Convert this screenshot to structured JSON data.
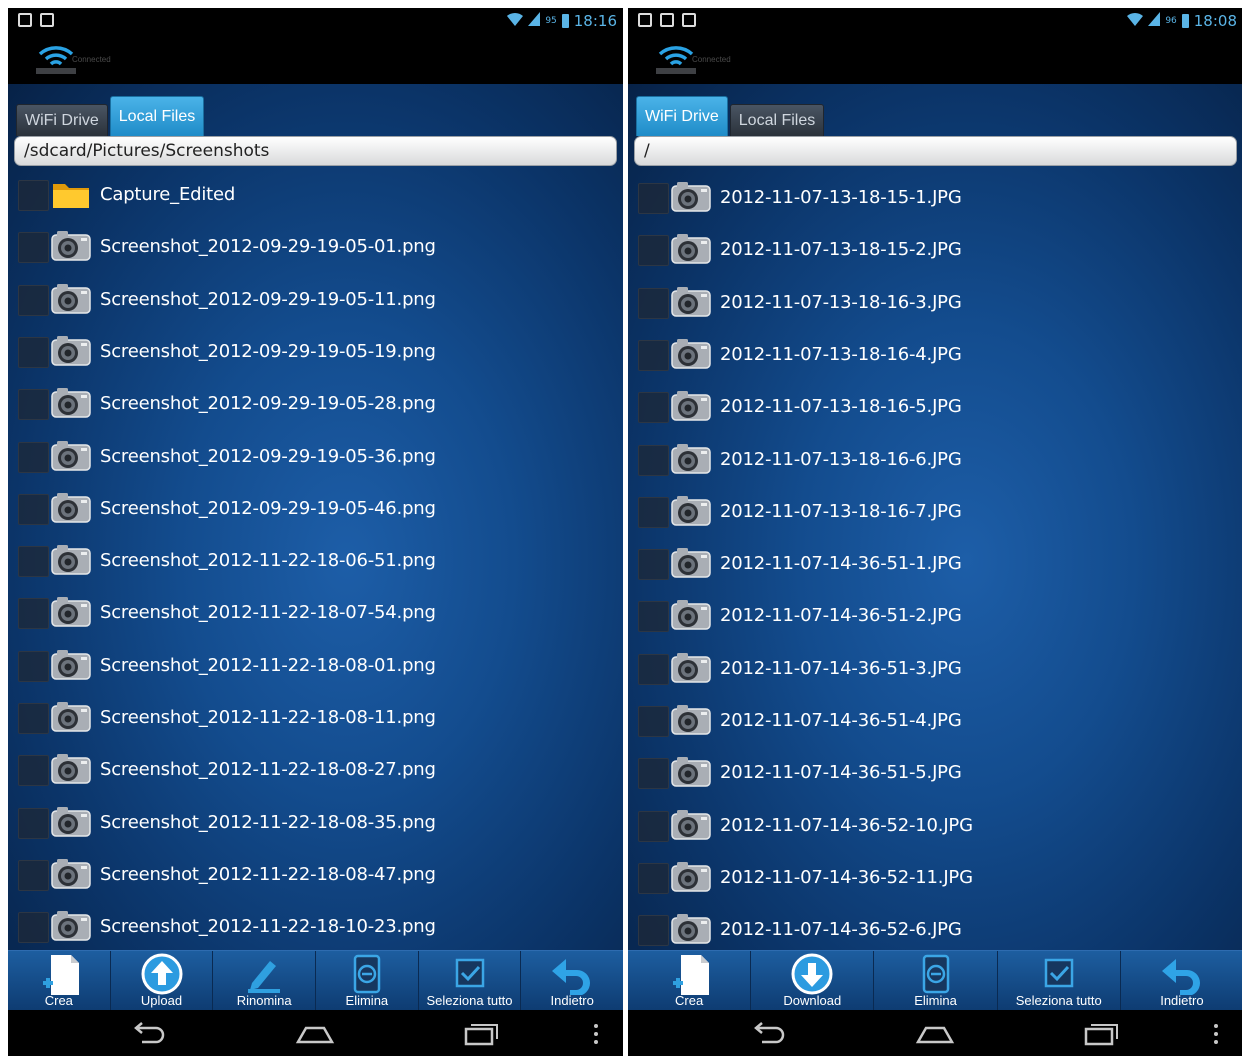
{
  "left": {
    "status": {
      "battery": "95",
      "time": "18:16"
    },
    "wifi_status": "Connected",
    "tabs": [
      {
        "label": "WiFi Drive",
        "active": false
      },
      {
        "label": "Local Files",
        "active": true
      }
    ],
    "path": "/sdcard/Pictures/Screenshots",
    "files": [
      {
        "name": "Capture_Edited",
        "icon": "folder-icon"
      },
      {
        "name": "Screenshot_2012-09-29-19-05-01.png",
        "icon": "camera-icon"
      },
      {
        "name": "Screenshot_2012-09-29-19-05-11.png",
        "icon": "camera-icon"
      },
      {
        "name": "Screenshot_2012-09-29-19-05-19.png",
        "icon": "camera-icon"
      },
      {
        "name": "Screenshot_2012-09-29-19-05-28.png",
        "icon": "camera-icon"
      },
      {
        "name": "Screenshot_2012-09-29-19-05-36.png",
        "icon": "camera-icon"
      },
      {
        "name": "Screenshot_2012-09-29-19-05-46.png",
        "icon": "camera-icon"
      },
      {
        "name": "Screenshot_2012-11-22-18-06-51.png",
        "icon": "camera-icon"
      },
      {
        "name": "Screenshot_2012-11-22-18-07-54.png",
        "icon": "camera-icon"
      },
      {
        "name": "Screenshot_2012-11-22-18-08-01.png",
        "icon": "camera-icon"
      },
      {
        "name": "Screenshot_2012-11-22-18-08-11.png",
        "icon": "camera-icon"
      },
      {
        "name": "Screenshot_2012-11-22-18-08-27.png",
        "icon": "camera-icon"
      },
      {
        "name": "Screenshot_2012-11-22-18-08-35.png",
        "icon": "camera-icon"
      },
      {
        "name": "Screenshot_2012-11-22-18-08-47.png",
        "icon": "camera-icon"
      },
      {
        "name": "Screenshot_2012-11-22-18-10-23.png",
        "icon": "camera-icon"
      }
    ],
    "toolbar": [
      {
        "label": "Crea",
        "icon": "new-file-icon"
      },
      {
        "label": "Upload",
        "icon": "upload-icon"
      },
      {
        "label": "Rinomina",
        "icon": "rename-icon"
      },
      {
        "label": "Elimina",
        "icon": "delete-icon"
      },
      {
        "label": "Seleziona tutto",
        "icon": "select-all-icon"
      },
      {
        "label": "Indietro",
        "icon": "back-arrow-icon"
      }
    ]
  },
  "right": {
    "status": {
      "battery": "96",
      "time": "18:08"
    },
    "wifi_status": "Connected",
    "tabs": [
      {
        "label": "WiFi Drive",
        "active": true
      },
      {
        "label": "Local Files",
        "active": false
      }
    ],
    "path": "/",
    "files": [
      {
        "name": "2012-11-07-13-18-15-1.JPG",
        "icon": "camera-icon"
      },
      {
        "name": "2012-11-07-13-18-15-2.JPG",
        "icon": "camera-icon"
      },
      {
        "name": "2012-11-07-13-18-16-3.JPG",
        "icon": "camera-icon"
      },
      {
        "name": "2012-11-07-13-18-16-4.JPG",
        "icon": "camera-icon"
      },
      {
        "name": "2012-11-07-13-18-16-5.JPG",
        "icon": "camera-icon"
      },
      {
        "name": "2012-11-07-13-18-16-6.JPG",
        "icon": "camera-icon"
      },
      {
        "name": "2012-11-07-13-18-16-7.JPG",
        "icon": "camera-icon"
      },
      {
        "name": "2012-11-07-14-36-51-1.JPG",
        "icon": "camera-icon"
      },
      {
        "name": "2012-11-07-14-36-51-2.JPG",
        "icon": "camera-icon"
      },
      {
        "name": "2012-11-07-14-36-51-3.JPG",
        "icon": "camera-icon"
      },
      {
        "name": "2012-11-07-14-36-51-4.JPG",
        "icon": "camera-icon"
      },
      {
        "name": "2012-11-07-14-36-51-5.JPG",
        "icon": "camera-icon"
      },
      {
        "name": "2012-11-07-14-36-52-10.JPG",
        "icon": "camera-icon"
      },
      {
        "name": "2012-11-07-14-36-52-11.JPG",
        "icon": "camera-icon"
      },
      {
        "name": "2012-11-07-14-36-52-6.JPG",
        "icon": "camera-icon"
      }
    ],
    "toolbar": [
      {
        "label": "Crea",
        "icon": "new-file-icon"
      },
      {
        "label": "Download",
        "icon": "download-icon"
      },
      {
        "label": "Elimina",
        "icon": "delete-icon"
      },
      {
        "label": "Seleziona tutto",
        "icon": "select-all-icon"
      },
      {
        "label": "Indietro",
        "icon": "back-arrow-icon"
      }
    ]
  },
  "colors": {
    "accent": "#33a6e0",
    "background": "#0f427f",
    "clock": "#5ab4e6"
  }
}
